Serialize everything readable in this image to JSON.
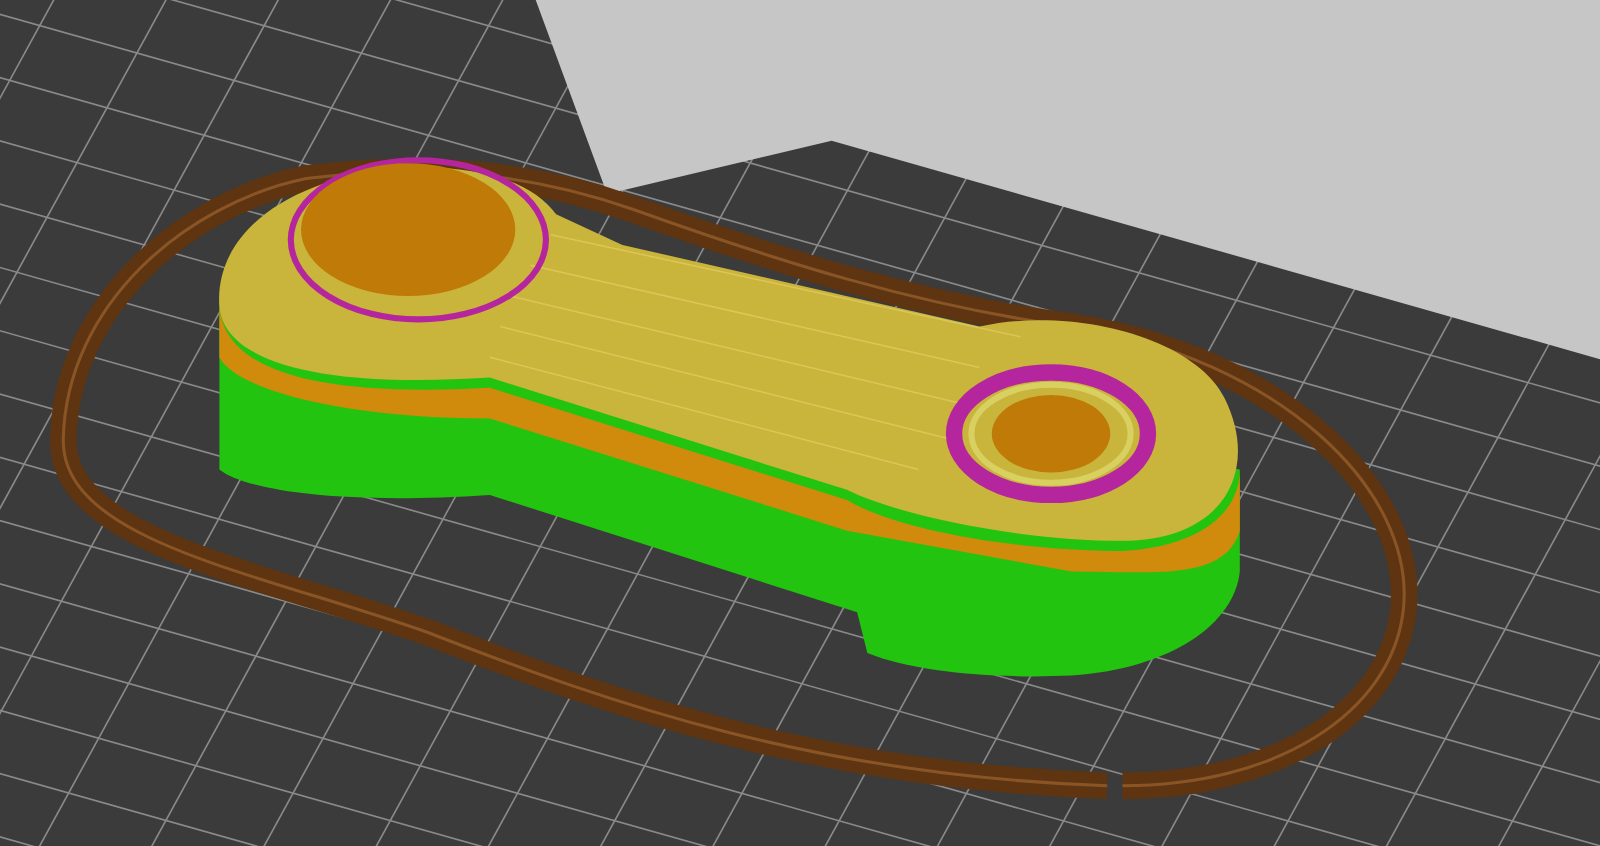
{
  "viewport": {
    "show_wall": true,
    "show_skirt": true
  }
}
